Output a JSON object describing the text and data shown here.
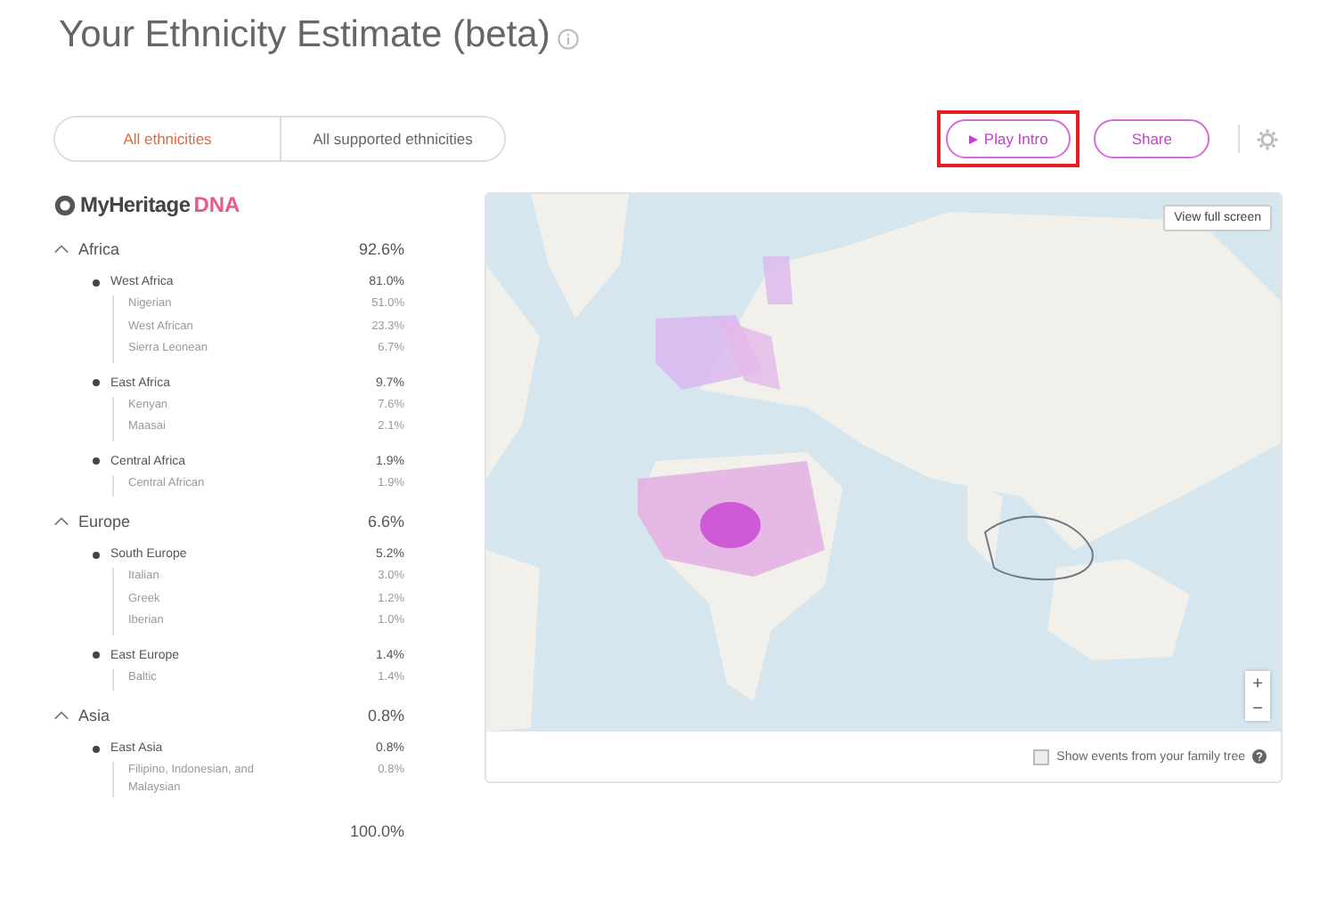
{
  "title": "Your Ethnicity Estimate (beta)",
  "tabs": [
    {
      "label": "All ethnicities",
      "selected": true
    },
    {
      "label": "All supported ethnicities",
      "selected": false
    }
  ],
  "actions": [
    {
      "label": "Play Intro",
      "kind": "play",
      "highlighted": true
    },
    {
      "label": "Share",
      "kind": "plain",
      "highlighted": false
    }
  ],
  "logo": {
    "name": "MyHeritage",
    "suffix": "DNA"
  },
  "regions": [
    {
      "name": "Africa",
      "percent": "92.6%",
      "expanded": true,
      "children": [
        {
          "name": "West Africa",
          "percent": "81.0%",
          "children": [
            {
              "name": "Nigerian",
              "percent": "51.0%"
            },
            {
              "name": "West African",
              "percent": "23.3%"
            },
            {
              "name": "Sierra Leonean",
              "percent": "6.7%"
            }
          ]
        },
        {
          "name": "East Africa",
          "percent": "9.7%",
          "children": [
            {
              "name": "Kenyan",
              "percent": "7.6%"
            },
            {
              "name": "Maasai",
              "percent": "2.1%"
            }
          ]
        },
        {
          "name": "Central Africa",
          "percent": "1.9%",
          "children": [
            {
              "name": "Central African",
              "percent": "1.9%"
            }
          ]
        }
      ]
    },
    {
      "name": "Europe",
      "percent": "6.6%",
      "expanded": true,
      "children": [
        {
          "name": "South Europe",
          "percent": "5.2%",
          "children": [
            {
              "name": "Italian",
              "percent": "3.0%"
            },
            {
              "name": "Greek",
              "percent": "1.2%"
            },
            {
              "name": "Iberian",
              "percent": "1.0%"
            }
          ]
        },
        {
          "name": "East Europe",
          "percent": "1.4%",
          "children": [
            {
              "name": "Baltic",
              "percent": "1.4%"
            }
          ]
        }
      ]
    },
    {
      "name": "Asia",
      "percent": "0.8%",
      "expanded": true,
      "children": [
        {
          "name": "East Asia",
          "percent": "0.8%",
          "children": [
            {
              "name": "Filipino, Indonesian, and Malaysian",
              "percent": "0.8%"
            }
          ]
        }
      ]
    }
  ],
  "total": "100.0%",
  "map": {
    "fullscreen_button": "View full screen",
    "zoom_in": "+",
    "zoom_out": "−"
  },
  "family_tree_option": {
    "label": "Show events from your family tree",
    "checked": false
  }
}
